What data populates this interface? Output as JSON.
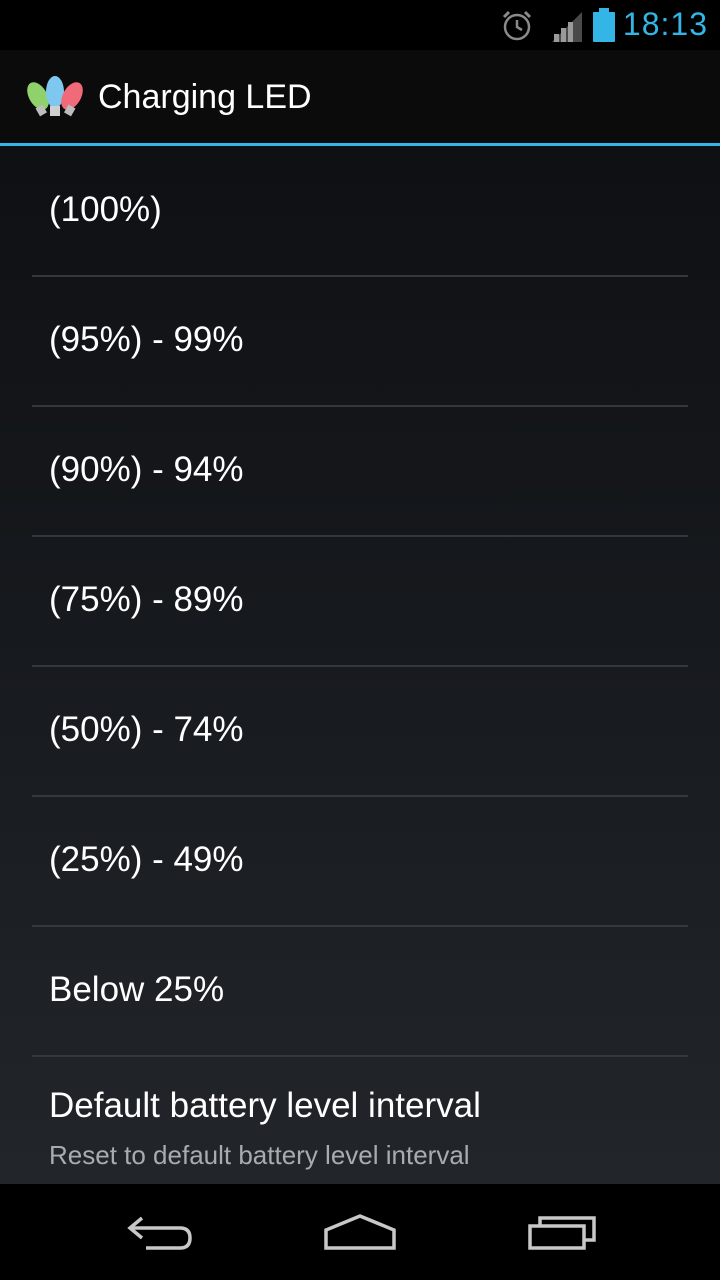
{
  "status_bar": {
    "time": "18:13",
    "icons": [
      "alarm-icon",
      "signal-icon",
      "battery-icon"
    ],
    "accent_color": "#33b5e5"
  },
  "action_bar": {
    "title": "Charging LED",
    "icon": "christmas-lights-icon"
  },
  "list": {
    "items": [
      {
        "label": "(100%)"
      },
      {
        "label": "(95%) - 99%"
      },
      {
        "label": "(90%) - 94%"
      },
      {
        "label": "(75%) - 89%"
      },
      {
        "label": "(50%) - 74%"
      },
      {
        "label": "(25%) - 49%"
      },
      {
        "label": "Below 25%"
      },
      {
        "label": "Default battery level interval",
        "summary": "Reset to default battery level interval"
      }
    ]
  },
  "nav_bar": {
    "buttons": [
      "back-icon",
      "home-icon",
      "recent-apps-icon"
    ]
  }
}
